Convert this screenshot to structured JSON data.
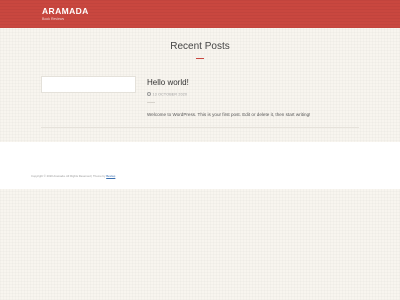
{
  "header": {
    "site_title": "ARAMADA",
    "tagline": "Book Reviews"
  },
  "main": {
    "section_title": "Recent Posts",
    "posts": [
      {
        "title": "Hello world!",
        "date": "13 OCTOBER 2020",
        "excerpt": "Welcome to WordPress. This is your first post. Edit or delete it, then start writing!"
      }
    ]
  },
  "footer": {
    "copyright": "Copyright © 2020 Aramada. All Rights Reserved | Theme by ",
    "theme_link": "Bestwp"
  },
  "colors": {
    "accent": "#c9473f",
    "background": "#f8f5ef",
    "link": "#3a6fb0"
  },
  "icons": [
    "clock-icon"
  ]
}
